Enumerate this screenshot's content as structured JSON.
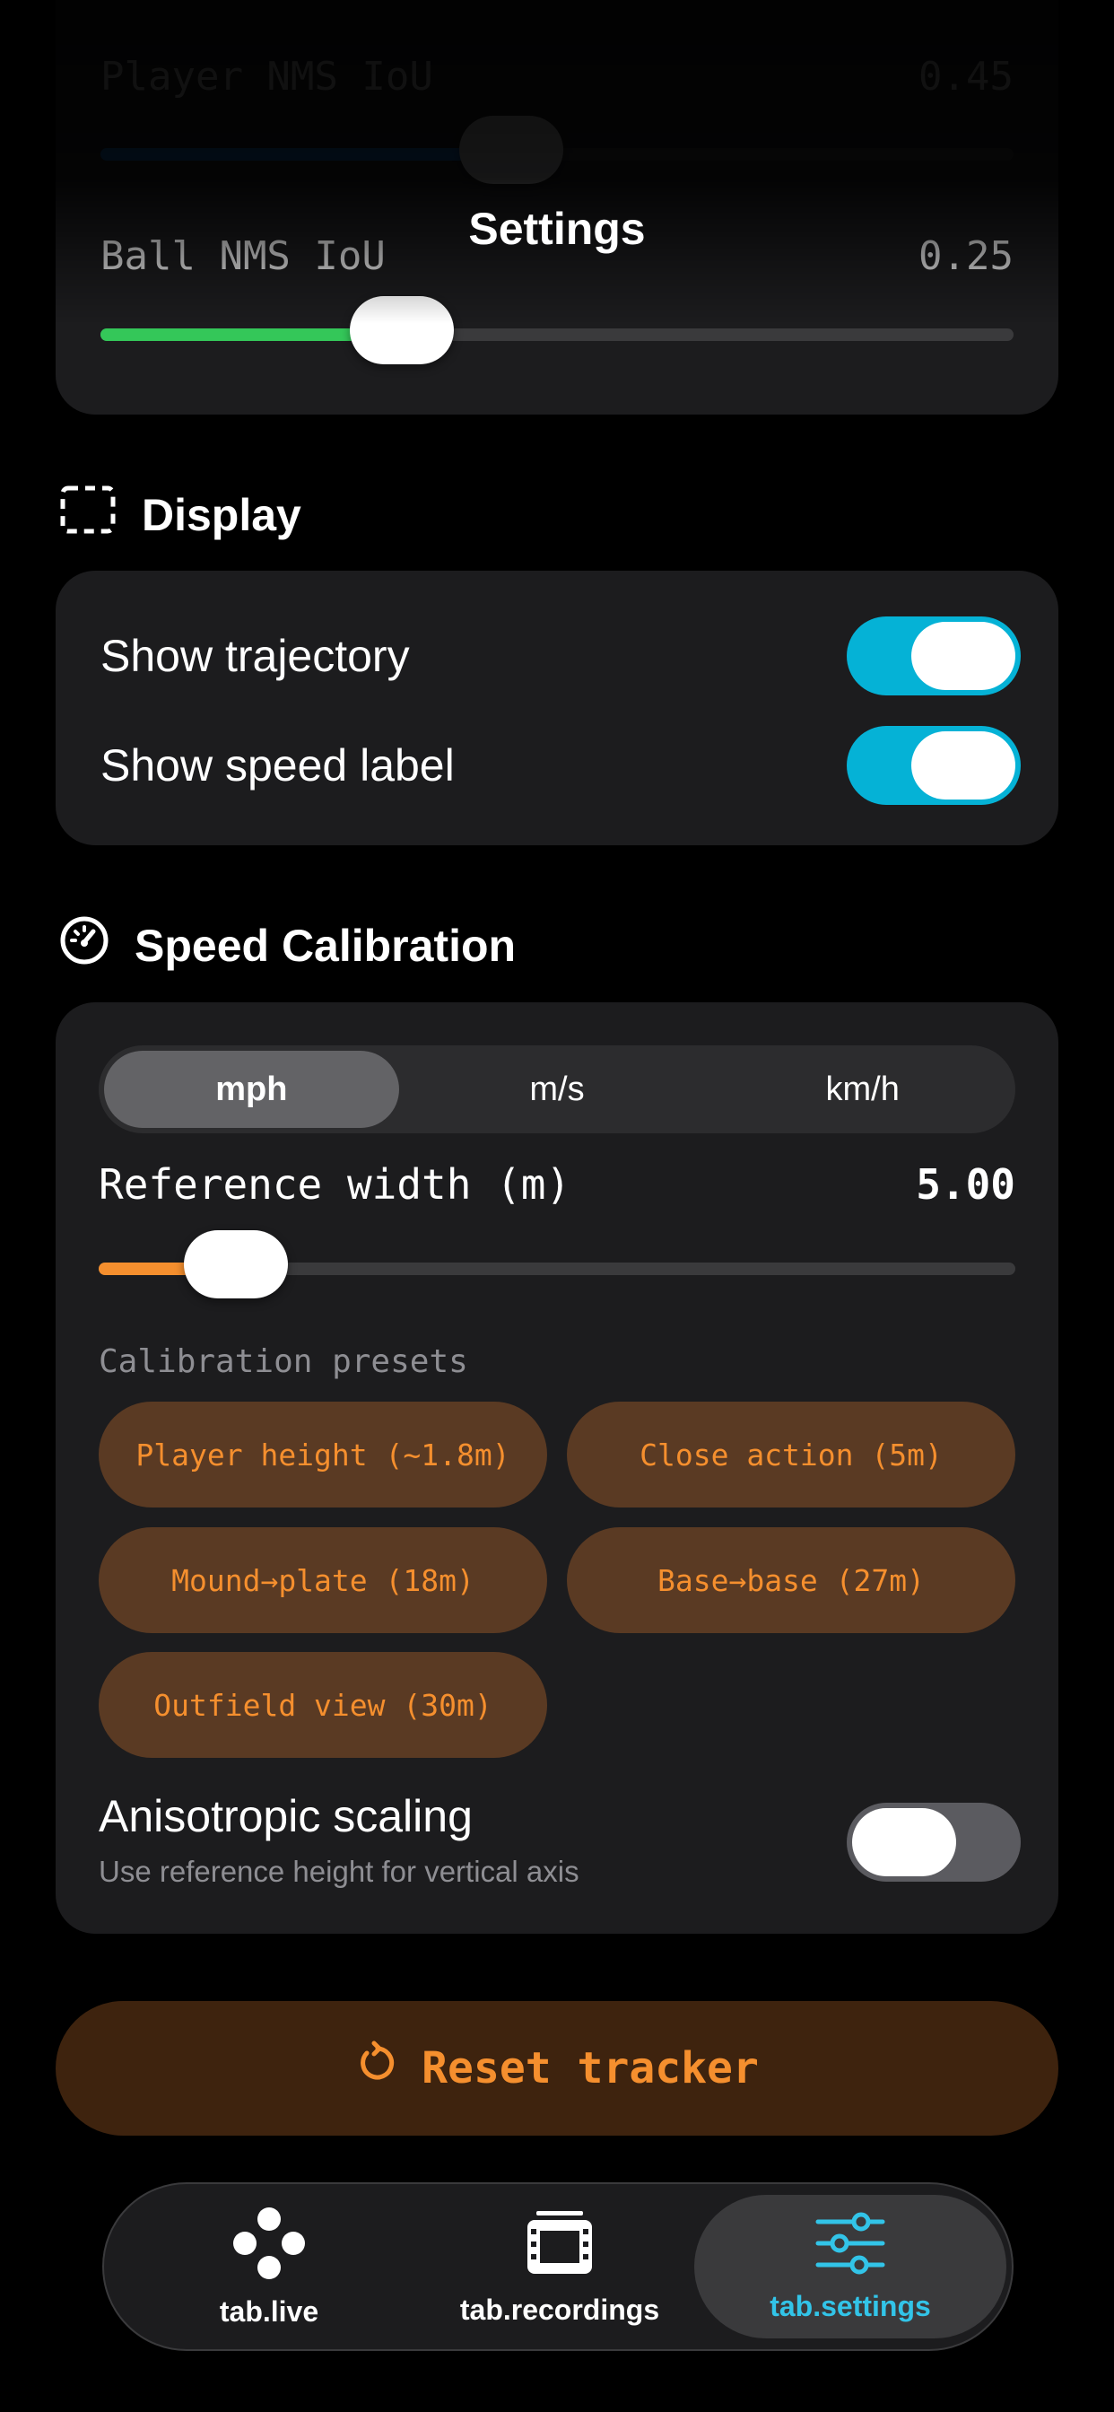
{
  "header": {
    "title": "Settings"
  },
  "detection": {
    "player_nms_label": "Player NMS IoU",
    "player_nms_value": "0.45",
    "player_nms_fraction": 0.45,
    "ball_nms_label": "Ball NMS IoU",
    "ball_nms_value": "0.25",
    "ball_nms_fraction": 0.33
  },
  "display": {
    "section_title": "Display",
    "show_trajectory_label": "Show trajectory",
    "show_trajectory_on": true,
    "show_speed_label_label": "Show speed label",
    "show_speed_label_on": true
  },
  "calibration": {
    "section_title": "Speed Calibration",
    "units": [
      "mph",
      "m/s",
      "km/h"
    ],
    "selected_unit": "mph",
    "reference_label": "Reference width (m)",
    "reference_value": "5.00",
    "reference_fraction": 0.15,
    "presets_label": "Calibration presets",
    "presets": [
      "Player height (~1.8m)",
      "Close action (5m)",
      "Mound→plate (18m)",
      "Base→base (27m)",
      "Outfield view (30m)"
    ],
    "aniso_title": "Anisotropic scaling",
    "aniso_subtitle": "Use reference height for vertical axis",
    "aniso_on": false
  },
  "reset": {
    "label": "Reset tracker"
  },
  "tabs": [
    {
      "label": "tab.live",
      "icon": "live-dots-icon"
    },
    {
      "label": "tab.recordings",
      "icon": "film-icon"
    },
    {
      "label": "tab.settings",
      "icon": "sliders-icon"
    }
  ],
  "colors": {
    "accent_cyan": "#05b2d6",
    "accent_orange": "#f58f2e",
    "slider_green": "#34c759",
    "slider_blue": "#0a84ff"
  }
}
